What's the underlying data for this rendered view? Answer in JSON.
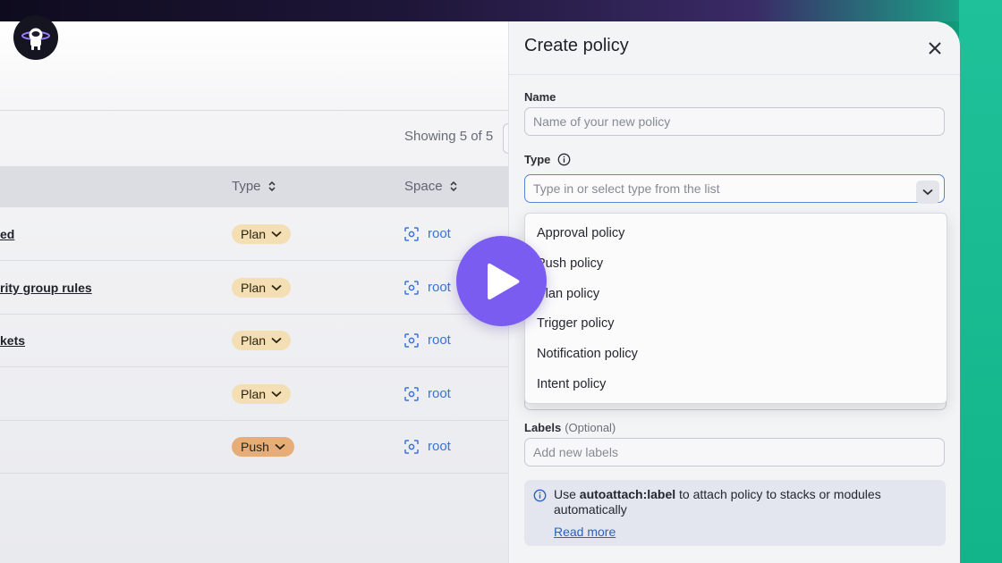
{
  "table": {
    "showing": "Showing 5 of 5",
    "columns": {
      "type": "Type",
      "space": "Space"
    },
    "rows": [
      {
        "name": "ed",
        "type": "Plan",
        "space": "root"
      },
      {
        "name": "rity group rules",
        "type": "Plan",
        "space": "root"
      },
      {
        "name": "kets",
        "type": "Plan",
        "space": "root"
      },
      {
        "name": "",
        "type": "Plan",
        "space": "root"
      },
      {
        "name": "",
        "type": "Push",
        "space": "root"
      }
    ]
  },
  "drawer": {
    "title": "Create policy",
    "name_label": "Name",
    "name_placeholder": "Name of your new policy",
    "type_label": "Type",
    "type_placeholder": "Type in or select type from the list",
    "dropdown_options": [
      "Approval policy",
      "Push policy",
      "Plan policy",
      "Trigger policy",
      "Notification policy",
      "Intent policy"
    ],
    "labels_label": "Labels",
    "labels_optional": "(Optional)",
    "labels_placeholder": "Add new labels",
    "info": {
      "prefix": "Use ",
      "keyword": "autoattach:label",
      "suffix": " to attach policy to stacks or modules automatically",
      "read_more": "Read more"
    }
  },
  "colors": {
    "accent_play": "#7b5cf0",
    "link": "#3b73d6",
    "plan_badge": "#f4dfb4",
    "push_badge": "#e6ad78"
  }
}
